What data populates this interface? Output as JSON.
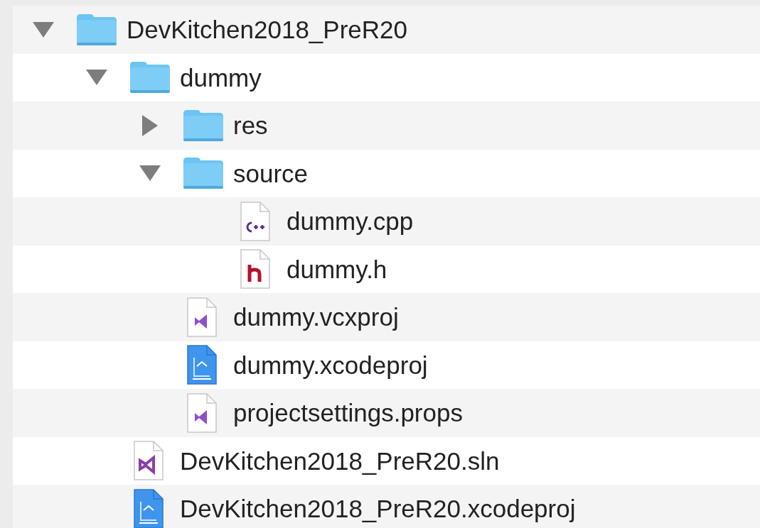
{
  "tree": [
    {
      "name": "DevKitchen2018_PreR20",
      "kind": "folder",
      "expanded": true,
      "children": [
        {
          "name": "dummy",
          "kind": "folder",
          "expanded": true,
          "children": [
            {
              "name": "res",
              "kind": "folder",
              "expanded": false
            },
            {
              "name": "source",
              "kind": "folder",
              "expanded": true,
              "children": [
                {
                  "name": "dummy.cpp",
                  "kind": "cpp"
                },
                {
                  "name": "dummy.h",
                  "kind": "header"
                }
              ]
            },
            {
              "name": "dummy.vcxproj",
              "kind": "vsproject"
            },
            {
              "name": "dummy.xcodeproj",
              "kind": "xcodeproject"
            },
            {
              "name": "projectsettings.props",
              "kind": "vsproject"
            }
          ]
        },
        {
          "name": "DevKitchen2018_PreR20.sln",
          "kind": "vssolution"
        },
        {
          "name": "DevKitchen2018_PreR20.xcodeproj",
          "kind": "xcodeproject"
        }
      ]
    }
  ]
}
